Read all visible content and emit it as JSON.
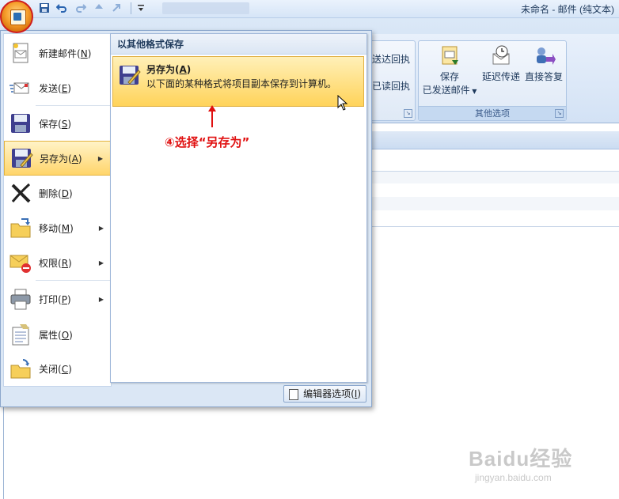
{
  "window": {
    "title": "未命名 - 邮件 (纯文本)"
  },
  "quick_access": [
    "save-icon",
    "undo-icon",
    "redo-icon",
    "up-icon",
    "forward-icon",
    "customize-icon"
  ],
  "ribbon": {
    "partial_receipt_1": "送达回执",
    "partial_receipt_2": "已读回执",
    "other_options_group": {
      "label": "其他选项",
      "save_sent_label_line1": "保存",
      "save_sent_label_line2": "已发送邮件",
      "delay_delivery": "延迟传递",
      "direct_replies": "直接答复"
    }
  },
  "office_menu": {
    "items": [
      {
        "label": "新建邮件",
        "key": "N",
        "icon": "new-mail-icon",
        "submenu": false
      },
      {
        "label": "发送",
        "key": "E",
        "icon": "send-icon",
        "submenu": false
      },
      {
        "label": "保存",
        "key": "S",
        "icon": "save-disk-icon",
        "submenu": false
      },
      {
        "label": "另存为",
        "key": "A",
        "icon": "save-as-icon",
        "submenu": true,
        "selected": true
      },
      {
        "label": "删除",
        "key": "D",
        "icon": "delete-icon",
        "submenu": false
      },
      {
        "label": "移动",
        "key": "M",
        "icon": "move-folder-icon",
        "submenu": true
      },
      {
        "label": "权限",
        "key": "R",
        "icon": "permission-icon",
        "submenu": true
      },
      {
        "label": "打印",
        "key": "P",
        "icon": "print-icon",
        "submenu": true
      },
      {
        "label": "属性",
        "key": "O",
        "icon": "properties-icon",
        "submenu": false
      },
      {
        "label": "关闭",
        "key": "C",
        "icon": "close-folder-icon",
        "submenu": false
      }
    ],
    "right_pane": {
      "title": "以其他格式保存",
      "option_title": "另存为(A)",
      "option_title_text": "另存为(",
      "option_title_key": "A",
      "option_title_end": ")",
      "option_description": "以下面的某种格式将项目副本保存到计算机。"
    },
    "annotation": "④选择“另存为”",
    "footer_button": {
      "label": "编辑器选项",
      "key": "I"
    }
  },
  "watermark": {
    "main": "Baidu经验",
    "sub": "jingyan.baidu.com"
  },
  "colors": {
    "accent_orange": "#f7a12e",
    "annotation_red": "#e01010",
    "ribbon_blue": "#c5d9f1",
    "highlight_yellow": "#ffd56b"
  }
}
